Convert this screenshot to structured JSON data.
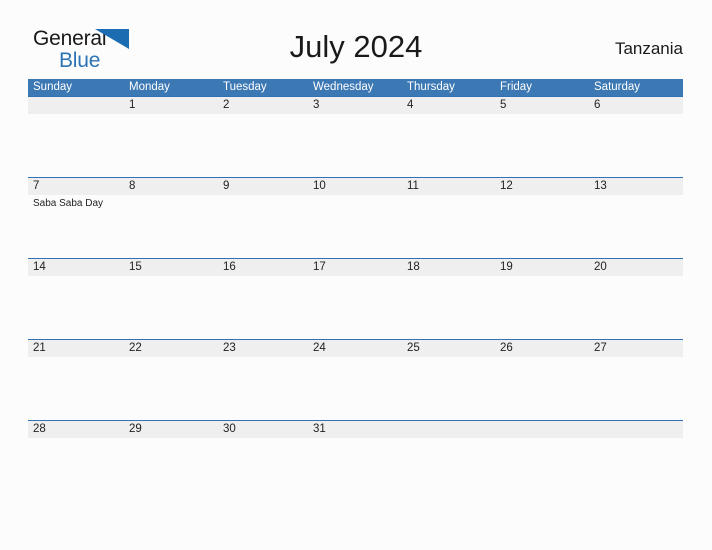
{
  "brand": {
    "name_part1": "General",
    "name_part2": "Blue",
    "flag_icon": "triangle-flag-icon",
    "color_primary": "#2e74b5",
    "color_text": "#1a1a1a"
  },
  "header": {
    "title": "July 2024",
    "country": "Tanzania"
  },
  "calendar": {
    "header_color": "#3c78b4",
    "band_color": "#efefef",
    "band_border_color": "#2e74b5",
    "weekdays": [
      "Sunday",
      "Monday",
      "Tuesday",
      "Wednesday",
      "Thursday",
      "Friday",
      "Saturday"
    ],
    "weeks": [
      [
        {
          "day": ""
        },
        {
          "day": "1"
        },
        {
          "day": "2"
        },
        {
          "day": "3"
        },
        {
          "day": "4"
        },
        {
          "day": "5"
        },
        {
          "day": "6"
        }
      ],
      [
        {
          "day": "7",
          "event": "Saba Saba Day"
        },
        {
          "day": "8"
        },
        {
          "day": "9"
        },
        {
          "day": "10"
        },
        {
          "day": "11"
        },
        {
          "day": "12"
        },
        {
          "day": "13"
        }
      ],
      [
        {
          "day": "14"
        },
        {
          "day": "15"
        },
        {
          "day": "16"
        },
        {
          "day": "17"
        },
        {
          "day": "18"
        },
        {
          "day": "19"
        },
        {
          "day": "20"
        }
      ],
      [
        {
          "day": "21"
        },
        {
          "day": "22"
        },
        {
          "day": "23"
        },
        {
          "day": "24"
        },
        {
          "day": "25"
        },
        {
          "day": "26"
        },
        {
          "day": "27"
        }
      ],
      [
        {
          "day": "28"
        },
        {
          "day": "29"
        },
        {
          "day": "30"
        },
        {
          "day": "31"
        },
        {
          "day": ""
        },
        {
          "day": ""
        },
        {
          "day": ""
        }
      ]
    ]
  }
}
